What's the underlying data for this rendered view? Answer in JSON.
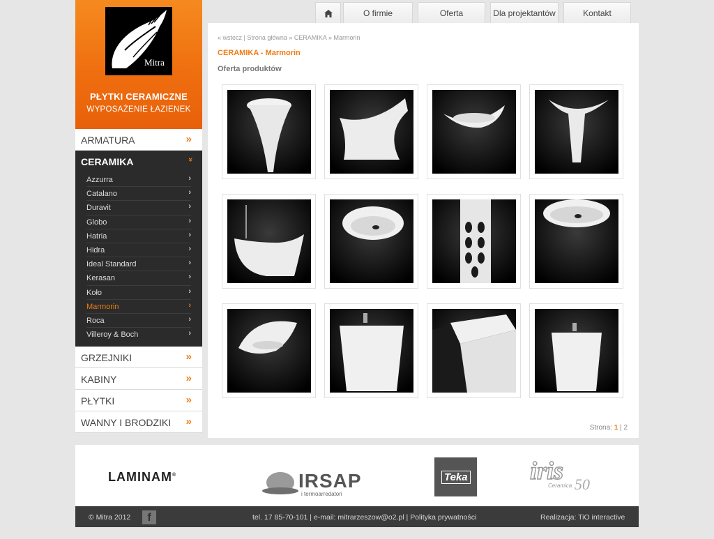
{
  "logo": {
    "brand": "Mitra"
  },
  "tagline": {
    "line1": "PŁYTKI CERAMICZNE",
    "line2": "WYPOSAŻENIE ŁAZIENEK"
  },
  "top_menu": [
    "O firmie",
    "Oferta",
    "Dla projektantów",
    "Kontakt"
  ],
  "nav": {
    "top_items": [
      {
        "label": "ARMATURA",
        "arrow": "»"
      }
    ],
    "active": {
      "label": "CERAMIKA",
      "arrow": "»"
    },
    "sub_items": [
      "Azzurra",
      "Catalano",
      "Duravit",
      "Globo",
      "Hatria",
      "Hidra",
      "Ideal Standard",
      "Kerasan",
      "Koło",
      "Marmorin",
      "Roca",
      "Villeroy & Boch"
    ],
    "current_sub": "Marmorin",
    "sub_arrow": "›",
    "bottom_items": [
      {
        "label": "GRZEJNIKI",
        "arrow": "»"
      },
      {
        "label": "KABINY",
        "arrow": "»"
      },
      {
        "label": "PŁYTKI",
        "arrow": "»"
      },
      {
        "label": "WANNY I BRODZIKI",
        "arrow": "»"
      }
    ]
  },
  "breadcrumb": {
    "back": "« wstecz",
    "sep1": " | ",
    "home": "Strona główna",
    "sep2": " » ",
    "cat": "CERAMIKA",
    "sep3": " » ",
    "cur": "Marmorin"
  },
  "content": {
    "heading": "CERAMIKA - Marmorin",
    "subheading": "Oferta produktów"
  },
  "products_count_label": "",
  "pager": {
    "label": "Stronа:",
    "current": "1",
    "sep": " | ",
    "next": "2"
  },
  "brands": {
    "laminam": "LAMINAM",
    "irsap": "IRSAP",
    "irsap_sub": "i termoarredatori",
    "teka": "Teka",
    "iris": "iris",
    "iris_sub": "Ceramica",
    "iris_num": "50"
  },
  "footer": {
    "copyright": "© Mitra 2012",
    "fb": "f",
    "contact": "tel. 17 85-70-101 | e-mail: mitrarzeszow@o2.pl | Polityka prywatności",
    "credit": "Realizacja: TiO interactive"
  },
  "colors": {
    "accent": "#f07c14",
    "dark": "#2b2b2b"
  }
}
